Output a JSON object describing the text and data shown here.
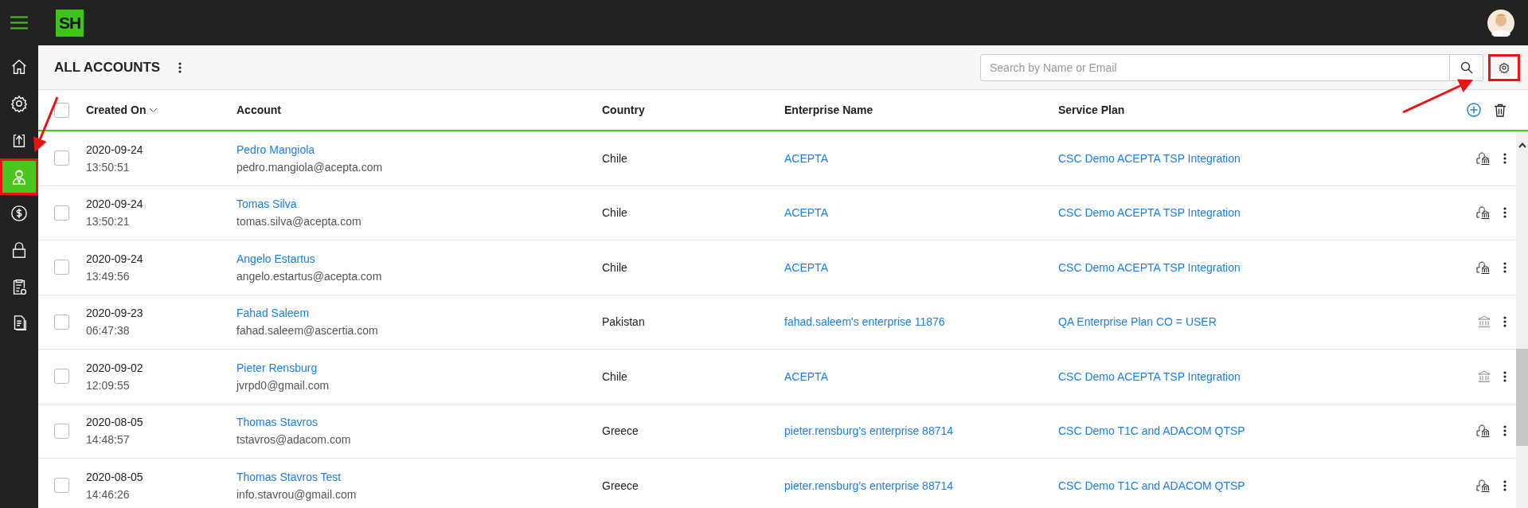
{
  "topbar": {
    "logo": "SH"
  },
  "sidebar": {
    "items": [
      {
        "kind": "home",
        "selected": false,
        "highlighted": false
      },
      {
        "kind": "gear",
        "selected": false,
        "highlighted": false
      },
      {
        "kind": "upload",
        "selected": false,
        "highlighted": false
      },
      {
        "kind": "user",
        "selected": true,
        "highlighted": true
      },
      {
        "kind": "dollar",
        "selected": false,
        "highlighted": false
      },
      {
        "kind": "lock",
        "selected": false,
        "highlighted": false
      },
      {
        "kind": "clipboard",
        "selected": false,
        "highlighted": false
      },
      {
        "kind": "document",
        "selected": false,
        "highlighted": false
      }
    ]
  },
  "toolbar": {
    "title": "ALL ACCOUNTS",
    "search": {
      "placeholder": "Search by Name or Email"
    },
    "settings_highlighted": true
  },
  "table": {
    "all_checked": false,
    "columns": [
      "Created On",
      "Account",
      "Country",
      "Enterprise Name",
      "Service Plan"
    ],
    "rows": [
      {
        "date": "2020-09-24",
        "time": "13:50:51",
        "name": "Pedro Mangiola",
        "email": "pedro.mangiola@acepta.com",
        "country": "Chile",
        "enterprise": "ACEPTA",
        "plan": "CSC Demo ACEPTA TSP Integration",
        "kind": "user-bank",
        "checked": false
      },
      {
        "date": "2020-09-24",
        "time": "13:50:21",
        "name": "Tomas Silva",
        "email": "tomas.silva@acepta.com",
        "country": "Chile",
        "enterprise": "ACEPTA",
        "plan": "CSC Demo ACEPTA TSP Integration",
        "kind": "user-bank",
        "checked": false
      },
      {
        "date": "2020-09-24",
        "time": "13:49:56",
        "name": "Angelo Estartus",
        "email": "angelo.estartus@acepta.com",
        "country": "Chile",
        "enterprise": "ACEPTA",
        "plan": "CSC Demo ACEPTA TSP Integration",
        "kind": "user-bank",
        "checked": false
      },
      {
        "date": "2020-09-23",
        "time": "06:47:38",
        "name": "Fahad Saleem",
        "email": "fahad.saleem@ascertia.com",
        "country": "Pakistan",
        "enterprise": "fahad.saleem's enterprise 11876",
        "plan": "QA Enterprise Plan CO = USER",
        "kind": "bank",
        "checked": false
      },
      {
        "date": "2020-09-02",
        "time": "12:09:55",
        "name": "Pieter Rensburg",
        "email": "jvrpd0@gmail.com",
        "country": "Chile",
        "enterprise": "ACEPTA",
        "plan": "CSC Demo ACEPTA TSP Integration",
        "kind": "bank",
        "checked": false
      },
      {
        "date": "2020-08-05",
        "time": "14:48:57",
        "name": "Thomas Stavros",
        "email": "tstavros@adacom.com",
        "country": "Greece",
        "enterprise": "pieter.rensburg's enterprise 88714",
        "plan": "CSC Demo T1C and ADACOM QTSP",
        "kind": "user-bank",
        "checked": false
      },
      {
        "date": "2020-08-05",
        "time": "14:46:26",
        "name": "Thomas Stavros Test",
        "email": "info.stavrou@gmail.com",
        "country": "Greece",
        "enterprise": "pieter.rensburg's enterprise 88714",
        "plan": "CSC Demo T1C and ADACOM QTSP",
        "kind": "user-bank",
        "checked": false
      }
    ]
  }
}
